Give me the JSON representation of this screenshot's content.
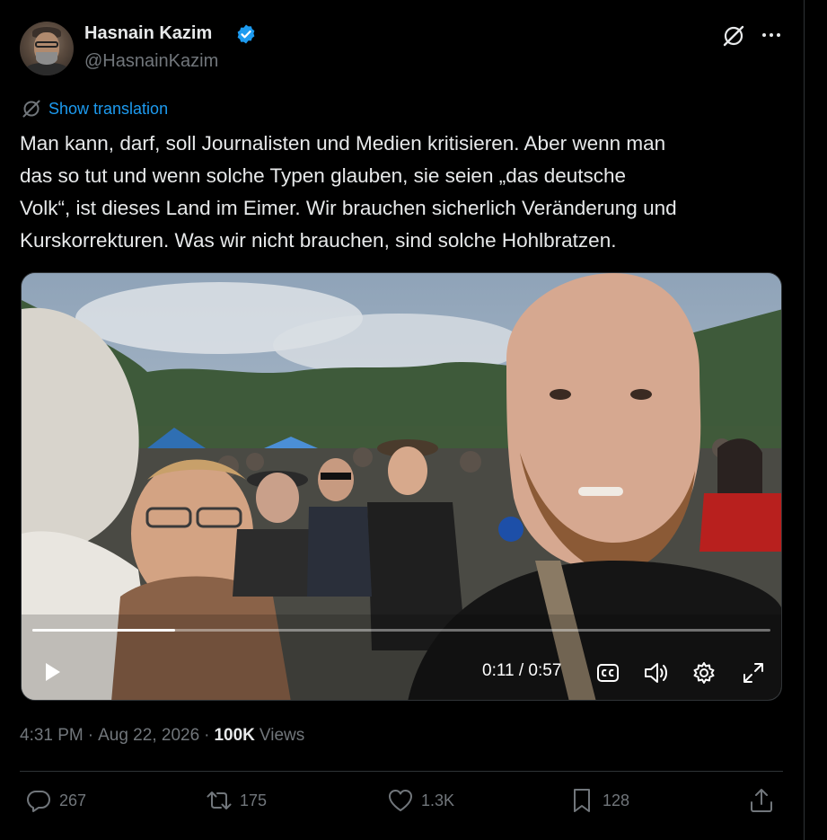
{
  "author": {
    "name": "Hasnain Kazim",
    "handle": "@HasnainKazim",
    "verified_color": "#1d9bf0"
  },
  "header_icons": [
    "grok-icon",
    "more-icon"
  ],
  "translation": {
    "label": "Show translation"
  },
  "tweet": {
    "text": "Man kann, darf, soll Journalisten und Medien kritisieren. Aber wenn man\ndas so tut und wenn solche Typen glauben, sie seien „das deutsche\nVolk“, ist dieses Land im Eimer. Wir brauchen sicherlich Veränderung und\nKurskorrekturen. Was wir nicht brauchen, sind solche Hohlbratzen."
  },
  "video": {
    "time_display": "0:11 / 0:57",
    "progress": 0.193,
    "controls": [
      "play-icon",
      "captions-icon",
      "volume-icon",
      "settings-icon",
      "fullscreen-icon"
    ]
  },
  "meta": {
    "time": "4:31 PM",
    "separator1": "·",
    "date": "Aug 22, 2026",
    "separator2": "·",
    "views_count": "100K",
    "views_label": "Views"
  },
  "actions": {
    "replies": "267",
    "reposts": "175",
    "likes": "1.3K",
    "bookmarks": "128"
  },
  "colors": {
    "background": "#000000",
    "text": "#e7e9ea",
    "muted": "#71767b",
    "accent": "#1d9bf0",
    "border": "#2f3336"
  }
}
